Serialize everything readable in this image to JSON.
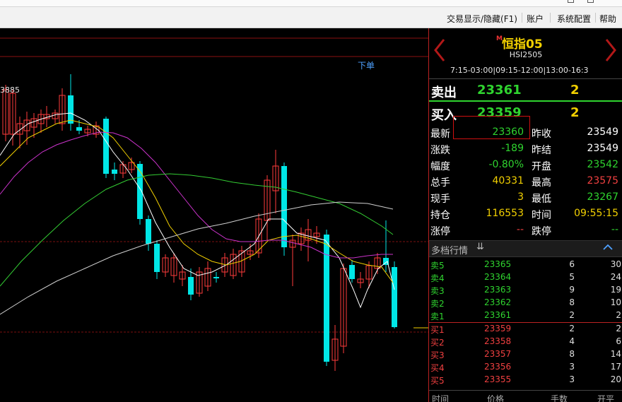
{
  "menubar": {
    "items": [
      "交易显示/隐藏(F1)",
      "账户",
      "系统配置",
      "帮助"
    ]
  },
  "chart": {
    "order_button": "下单",
    "price_marker": "3885",
    "colors": {
      "up": "#ff3b3b",
      "down": "#00e6e6",
      "ma5": "#ffffff",
      "ma10": "#f2d000",
      "ma20": "#cc33cc",
      "ma60": "#33cc33"
    }
  },
  "panel": {
    "symbol_marker": "M",
    "symbol_name": "恒指05",
    "symbol_code": "HSI2505",
    "trading_hours": "7:15-03:00|09:15-12:00|13:00-16:3",
    "ask": {
      "label": "卖出",
      "price": "23361",
      "volume": "2"
    },
    "bid": {
      "label": "买入",
      "price": "23359",
      "volume": "2"
    },
    "stats": [
      {
        "l1": "最新",
        "v1": "23360",
        "c1": "green",
        "l2": "昨收",
        "v2": "23549",
        "c2": "white"
      },
      {
        "l1": "涨跌",
        "v1": "-189",
        "c1": "green",
        "l2": "昨结",
        "v2": "23549",
        "c2": "white"
      },
      {
        "l1": "幅度",
        "v1": "-0.80%",
        "c1": "green",
        "l2": "开盘",
        "v2": "23542",
        "c2": "green"
      },
      {
        "l1": "总手",
        "v1": "40331",
        "c1": "yellow",
        "l2": "最高",
        "v2": "23575",
        "c2": "red"
      },
      {
        "l1": "现手",
        "v1": "3",
        "c1": "yellow",
        "l2": "最低",
        "v2": "23267",
        "c2": "green"
      },
      {
        "l1": "持仓",
        "v1": "116553",
        "c1": "yellow",
        "l2": "时间",
        "v2": "09:55:15",
        "c2": "yellow"
      },
      {
        "l1": "涨停",
        "v1": "--",
        "c1": "red",
        "l2": "跌停",
        "v2": "--",
        "c2": "green"
      }
    ],
    "depth_title": "多档行情",
    "asks": [
      {
        "label": "卖5",
        "price": "23365",
        "qty": "6",
        "total": "30"
      },
      {
        "label": "卖4",
        "price": "23364",
        "qty": "5",
        "total": "24"
      },
      {
        "label": "卖3",
        "price": "23363",
        "qty": "9",
        "total": "19"
      },
      {
        "label": "卖2",
        "price": "23362",
        "qty": "8",
        "total": "10"
      },
      {
        "label": "卖1",
        "price": "23361",
        "qty": "2",
        "total": "2"
      }
    ],
    "bids": [
      {
        "label": "买1",
        "price": "23359",
        "qty": "2",
        "total": "2"
      },
      {
        "label": "买2",
        "price": "23358",
        "qty": "4",
        "total": "6"
      },
      {
        "label": "买3",
        "price": "23357",
        "qty": "8",
        "total": "14"
      },
      {
        "label": "买4",
        "price": "23356",
        "qty": "3",
        "total": "17"
      },
      {
        "label": "买5",
        "price": "23355",
        "qty": "3",
        "total": "20"
      }
    ],
    "tick_headers": [
      "时间",
      "价格",
      "手数",
      "开平"
    ]
  }
}
